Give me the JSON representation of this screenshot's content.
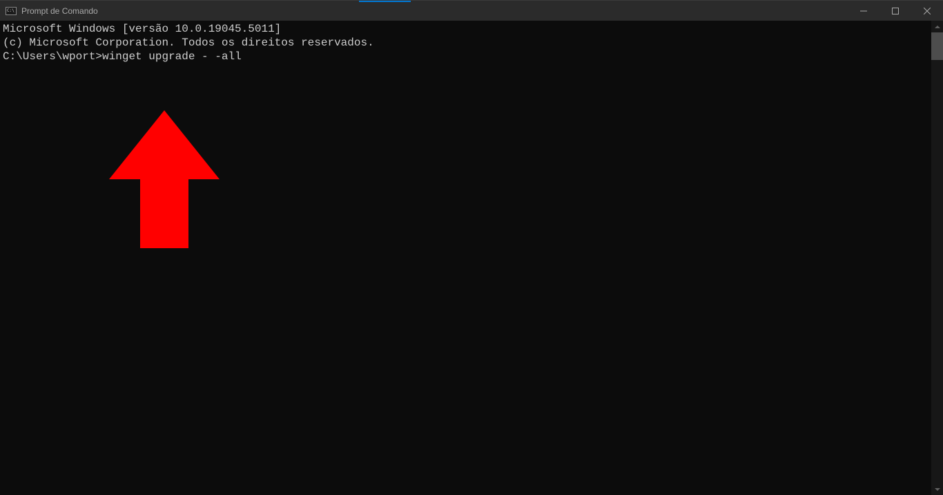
{
  "window": {
    "title": "Prompt de Comando"
  },
  "terminal": {
    "line1": "Microsoft Windows [versão 10.0.19045.5011]",
    "line2": "(c) Microsoft Corporation. Todos os direitos reservados.",
    "line3": "",
    "prompt": "C:\\Users\\wport>",
    "command": "winget upgrade - -all"
  }
}
